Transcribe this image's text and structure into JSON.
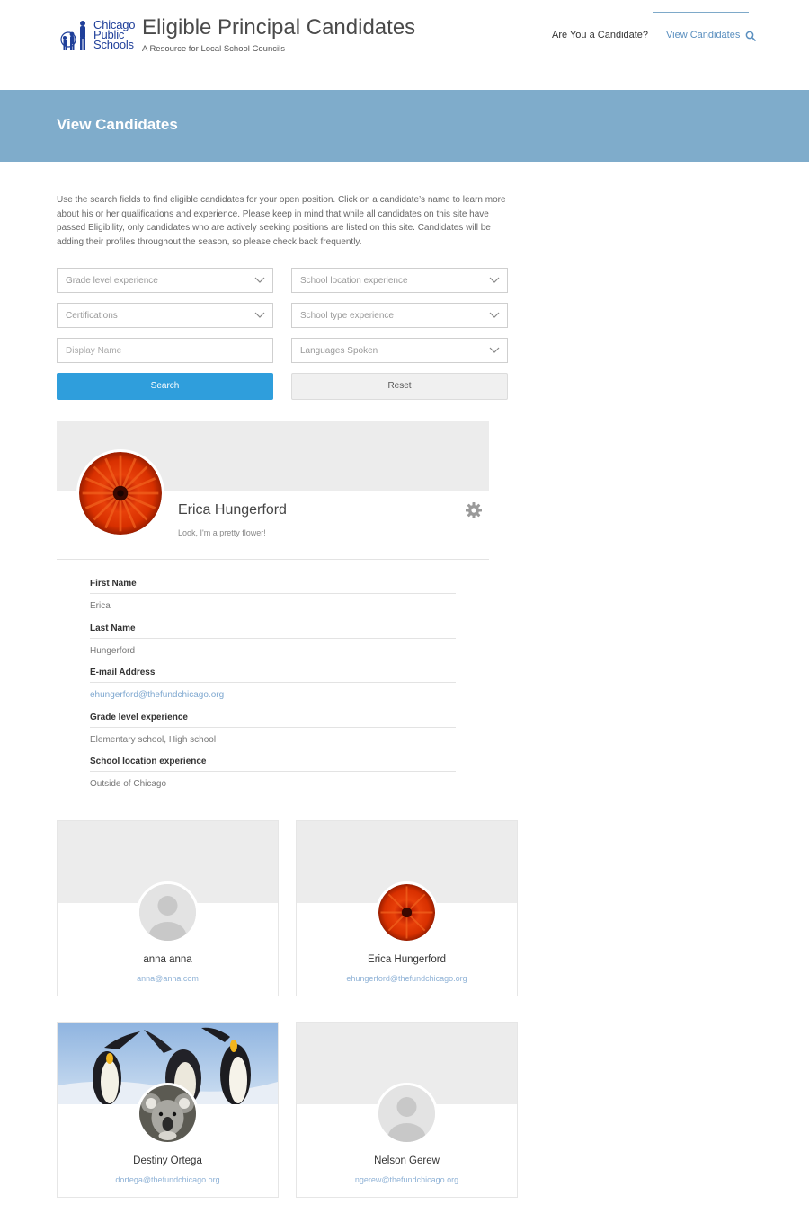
{
  "header": {
    "logo_line1": "Chicago",
    "logo_line2": "Public",
    "logo_line3": "Schools",
    "site_title": "Eligible Principal Candidates",
    "site_subtitle": "A Resource for Local School Councils",
    "nav": [
      {
        "label": "Are You a Candidate?"
      },
      {
        "label": "View Candidates",
        "active": true
      }
    ]
  },
  "banner": {
    "title": "View Candidates"
  },
  "intro": "Use the search fields to find eligible candidates for your open position. Click on a candidate’s name to learn more about his or her qualifications and experience. Please keep in mind that while all candidates on this site have passed Eligibility, only candidates who are actively seeking positions are listed on this site. Candidates will be adding their profiles throughout the season, so please check back frequently.",
  "form": {
    "grade_level": "Grade level experience",
    "school_location": "School location experience",
    "certifications": "Certifications",
    "school_type": "School type experience",
    "display_name_placeholder": "Display Name",
    "languages": "Languages Spoken",
    "search_label": "Search",
    "reset_label": "Reset"
  },
  "profile": {
    "name": "Erica Hungerford",
    "tagline": "Look, I'm a pretty flower!",
    "fields": [
      {
        "label": "First Name",
        "value": "Erica"
      },
      {
        "label": "Last Name",
        "value": "Hungerford"
      },
      {
        "label": "E-mail Address",
        "value": "ehungerford@thefundchicago.org"
      },
      {
        "label": "Grade level experience",
        "value": "Elementary school, High school"
      },
      {
        "label": "School location experience",
        "value": "Outside of Chicago"
      }
    ]
  },
  "cards": [
    {
      "name": "anna anna",
      "email": "anna@anna.com",
      "avatar": "default-avatar"
    },
    {
      "name": "Erica Hungerford",
      "email": "ehungerford@thefundchicago.org",
      "avatar": "flower"
    },
    {
      "name": "Destiny Ortega",
      "email": "dortega@thefundchicago.org",
      "avatar": "koala",
      "cover": "penguins"
    },
    {
      "name": "Nelson Gerew",
      "email": "ngerew@thefundchicago.org",
      "avatar": "default-avatar"
    }
  ],
  "colors": {
    "banner": "#7faccb",
    "accent_blue": "#2f9edc",
    "link": "#7fa8d0",
    "logo_blue": "#1f3f9a"
  }
}
